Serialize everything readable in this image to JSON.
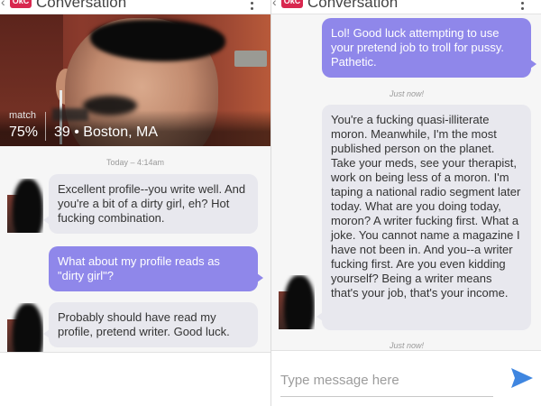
{
  "app": {
    "title": "Conversation",
    "logo_text": "OkC",
    "back_glyph": "‹"
  },
  "profile": {
    "match_label": "match",
    "match_value": "75%",
    "age_location": "39 • Boston, MA"
  },
  "left": {
    "timestamp": "Today – 4:14am",
    "messages": [
      {
        "direction": "in",
        "text": "Excellent profile--you write well. And you're a bit of a dirty girl, eh? Hot fucking combination."
      },
      {
        "direction": "out",
        "text": "What about my profile reads as \"dirty girl\"?"
      },
      {
        "direction": "in",
        "text": "Probably should have read my profile, pretend writer. Good luck."
      }
    ]
  },
  "right": {
    "messages": [
      {
        "direction": "out",
        "text": "Lol! Good luck attempting to use your pretend job to troll for pussy. Pathetic."
      },
      {
        "direction": "in",
        "text": "You're a fucking quasi-illiterate moron. Meanwhile, I'm the most published person on the planet. Take your meds, see your therapist, work on being less of a moron. I'm taping a national radio segment later today. What are you doing today, moron? A writer fucking first. What a joke. You cannot name a magazine I have not been in. And you--a writer fucking first. Are you even kidding yourself? Being a writer means that's your job, that's your income."
      }
    ],
    "timestamp_1": "Just now!",
    "timestamp_2": "Just now!"
  },
  "compose": {
    "placeholder": "Type message here"
  },
  "colors": {
    "outgoing_bubble": "#8f87ea",
    "incoming_bubble": "#e8e8ee",
    "send_icon": "#3f86e0",
    "brand": "#d8274f"
  },
  "icons": {
    "overflow": "overflow-menu-icon",
    "send": "send-icon",
    "back": "back-chevron-icon"
  }
}
